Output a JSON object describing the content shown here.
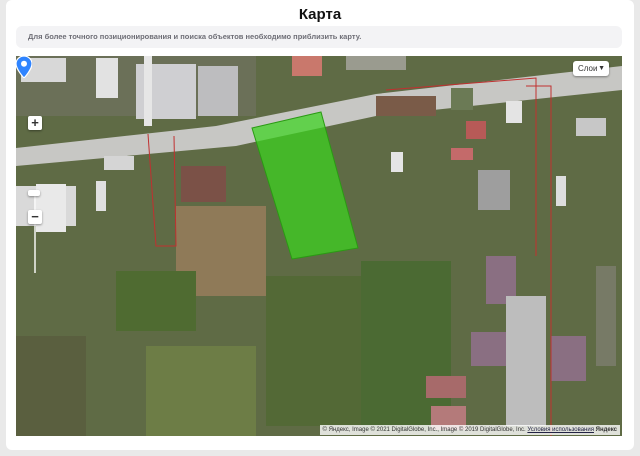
{
  "page": {
    "title": "Карта"
  },
  "hint": {
    "text": "Для более точного позиционирования и поиска объектов необходимо приблизить карту."
  },
  "map": {
    "controls": {
      "zoom_in": "+",
      "zoom_out": "−"
    },
    "layers_label": "Слои",
    "attribution": {
      "copy_text": "© Яндекс, Image © 2021 DigitalGlobe, Inc., Image © 2019 DigitalGlobe, Inc.",
      "terms_link": "Условия использования",
      "brand": "Яндекс"
    },
    "colors": {
      "parcel_fill": "#3bd41e",
      "marker": "#2f84ff",
      "boundary": "#c03030"
    }
  }
}
